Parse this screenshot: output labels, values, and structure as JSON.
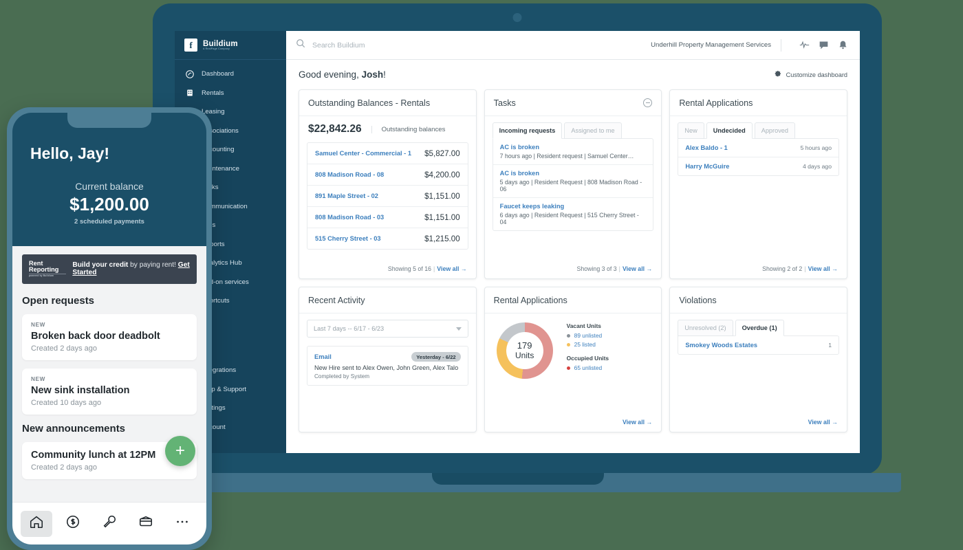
{
  "sidebar": {
    "brand": {
      "name": "Buildium",
      "sub": "A RealPage Company"
    },
    "items": [
      {
        "label": "Dashboard",
        "icon": "dashboard-icon"
      },
      {
        "label": "Rentals",
        "icon": "building-icon"
      },
      {
        "label": "Leasing",
        "icon": "key-icon"
      },
      {
        "label": "Associations",
        "icon": "association-icon"
      },
      {
        "label": "Accounting",
        "icon": "accounting-icon"
      },
      {
        "label": "Maintenance",
        "icon": "wrench-icon"
      },
      {
        "label": "Tasks",
        "icon": "tasks-icon"
      },
      {
        "label": "Communication",
        "icon": "communication-icon"
      },
      {
        "label": "Files",
        "icon": "files-icon"
      },
      {
        "label": "Reports",
        "icon": "reports-icon"
      },
      {
        "label": "Analytics Hub",
        "icon": "analytics-icon"
      },
      {
        "label": "Add-on services",
        "icon": "addon-icon"
      },
      {
        "label": "Shortcuts",
        "icon": "shortcuts-icon"
      }
    ],
    "bottom_items": [
      {
        "label": "Integrations",
        "icon": "integrations-icon"
      },
      {
        "label": "Help & Support",
        "icon": "help-icon"
      },
      {
        "label": "Settings",
        "icon": "settings-icon"
      },
      {
        "label": "Account",
        "icon": "account-icon"
      }
    ]
  },
  "topbar": {
    "search_placeholder": "Search Buildium",
    "org": "Underhill Property Management Services",
    "icons": [
      "activity-icon",
      "chat-icon",
      "bell-icon"
    ]
  },
  "header": {
    "greeting_prefix": "Good evening, ",
    "greeting_name": "Josh",
    "greeting_suffix": "!",
    "customize_label": "Customize dashboard"
  },
  "cards": {
    "outstanding": {
      "title": "Outstanding Balances - Rentals",
      "amount": "$22,842.26",
      "amount_label": "Outstanding balances",
      "rows": [
        {
          "name": "Samuel Center - Commercial - 1",
          "amount": "$5,827.00"
        },
        {
          "name": "808 Madison Road - 08",
          "amount": "$4,200.00"
        },
        {
          "name": "891 Maple Street - 02",
          "amount": "$1,151.00"
        },
        {
          "name": "808 Madison Road - 03",
          "amount": "$1,151.00"
        },
        {
          "name": "515 Cherry Street - 03",
          "amount": "$1,215.00"
        }
      ],
      "showing": "Showing 5 of 16",
      "view_all": "View all →"
    },
    "tasks": {
      "title": "Tasks",
      "tabs": [
        {
          "label": "Incoming requests",
          "active": true
        },
        {
          "label": "Assigned to me",
          "active": false
        }
      ],
      "rows": [
        {
          "title": "AC is broken",
          "meta": "7 hours ago | Resident request | Samuel Center…"
        },
        {
          "title": "AC is broken",
          "meta": "5 days ago | Resident Request | 808 Madison Road - 06"
        },
        {
          "title": "Faucet keeps leaking",
          "meta": "6 days ago | Resident Request | 515 Cherry Street - 04"
        }
      ],
      "showing": "Showing 3 of 3",
      "view_all": "View all →"
    },
    "rental_applications": {
      "title": "Rental Applications",
      "tabs": [
        {
          "label": "New",
          "active": false
        },
        {
          "label": "Undecided",
          "active": true
        },
        {
          "label": "Approved",
          "active": false
        }
      ],
      "rows": [
        {
          "name": "Alex Baldo - 1",
          "time": "5 hours ago"
        },
        {
          "name": "Harry McGuire",
          "time": "4 days ago"
        }
      ],
      "showing": "Showing 2 of 2",
      "view_all": "View all →"
    },
    "recent_activity": {
      "title": "Recent Activity",
      "range_value": "Last 7 days -- 6/17 - 6/23",
      "activity": {
        "kind": "Email",
        "badge": "Yesterday - 6/22",
        "description": "New Hire sent to Alex Owen, John Green, Alex Talo",
        "sub": "Completed by System"
      }
    },
    "units": {
      "title": "Rental Applications",
      "view_all": "View all →"
    },
    "violations": {
      "title": "Violations",
      "tabs": [
        {
          "label": "Unresolved (2)",
          "active": false
        },
        {
          "label": "Overdue (1)",
          "active": true
        }
      ],
      "rows": [
        {
          "name": "Smokey Woods Estates",
          "count": "1"
        }
      ],
      "view_all": "View all →"
    }
  },
  "chart_data": {
    "type": "pie",
    "title": "Rental Applications",
    "center_value": "179",
    "center_label": "Units",
    "total": 179,
    "legend_position": "right",
    "groups": [
      {
        "name": "Vacant Units",
        "items": [
          {
            "label": "89 unlisted",
            "value": 89,
            "color": "#8a9299"
          },
          {
            "label": "25  listed",
            "value": 25,
            "color": "#f5c15c"
          }
        ]
      },
      {
        "name": "Occupied Units",
        "items": [
          {
            "label": "65 unlisted",
            "value": 65,
            "color": "#d6413f"
          }
        ]
      }
    ],
    "slices": [
      {
        "name": "Occupied unlisted",
        "value": 65,
        "color": "#e09490",
        "sweep_deg": 186
      },
      {
        "name": "Vacant listed",
        "value": 25,
        "color": "#f5c15c",
        "sweep_deg": 110
      },
      {
        "name": "Vacant unlisted",
        "value": 89,
        "color": "#c3c7cb",
        "sweep_deg": 64
      }
    ]
  },
  "phone": {
    "hello": "Hello, Jay!",
    "balance_label": "Current balance",
    "balance": "$1,200.00",
    "balance_sub": "2 scheduled payments",
    "banner": {
      "label": "Rent Reporting",
      "label_sub": "powered by Buildium",
      "bold": "Build your credit",
      "rest": " by paying rent! ",
      "cta": "Get Started"
    },
    "open_requests_title": "Open requests",
    "open_requests": [
      {
        "badge": "NEW",
        "title": "Broken back door deadbolt",
        "sub": "Created 2 days ago"
      },
      {
        "badge": "NEW",
        "title": "New sink installation",
        "sub": "Created 10 days ago"
      }
    ],
    "announcements_title": "New announcements",
    "announcements": [
      {
        "title": "Community lunch at 12PM",
        "sub": "Created 2 days ago"
      }
    ],
    "fab": "+",
    "tabs": [
      {
        "icon": "home-icon",
        "active": true
      },
      {
        "icon": "payments-icon",
        "active": false
      },
      {
        "icon": "maintenance-icon",
        "active": false
      },
      {
        "icon": "account-card-icon",
        "active": false
      },
      {
        "icon": "more-icon",
        "active": false
      }
    ]
  },
  "colors": {
    "background": "#4a6d52",
    "laptop": "#1b5069",
    "sidebar": "#16445c",
    "link": "#3c7fbd",
    "accent_green": "#63b375"
  }
}
